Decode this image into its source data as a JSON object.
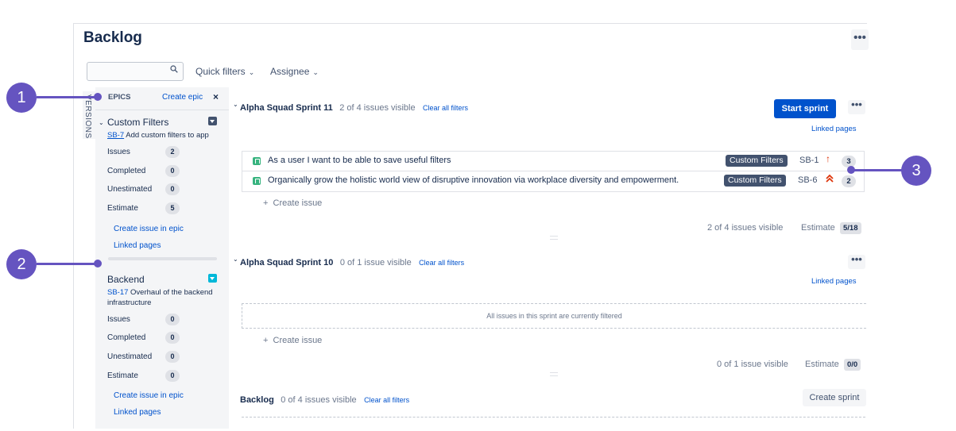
{
  "page": {
    "title": "Backlog",
    "top_more": "•••"
  },
  "toolbar": {
    "search_value": "",
    "quick_filters": "Quick filters",
    "assignee": "Assignee"
  },
  "versions_tab": "VERSIONS",
  "epics_panel": {
    "heading": "EPICS",
    "create_epic": "Create epic",
    "close": "×",
    "epics": [
      {
        "name": "Custom Filters",
        "key": "SB-7",
        "desc": "Add custom filters to app",
        "color": "#42526e",
        "stats": [
          {
            "label": "Issues",
            "value": "2"
          },
          {
            "label": "Completed",
            "value": "0"
          },
          {
            "label": "Unestimated",
            "value": "0"
          },
          {
            "label": "Estimate",
            "value": "5"
          }
        ],
        "create_issue": "Create issue in epic",
        "linked_pages": "Linked pages"
      },
      {
        "name": "Backend",
        "key": "SB-17",
        "desc": "Overhaul of the backend infrastructure",
        "color": "#00b8d9",
        "stats": [
          {
            "label": "Issues",
            "value": "0"
          },
          {
            "label": "Completed",
            "value": "0"
          },
          {
            "label": "Unestimated",
            "value": "0"
          },
          {
            "label": "Estimate",
            "value": "0"
          }
        ],
        "create_issue": "Create issue in epic",
        "linked_pages": "Linked pages"
      }
    ]
  },
  "sprints": [
    {
      "name": "Alpha Squad Sprint 11",
      "visible": "2 of 4 issues visible",
      "clear": "Clear all filters",
      "action": "Start sprint",
      "more": "•••",
      "linked_pages": "Linked pages",
      "issues": [
        {
          "summary": "As a user I want to be able to save useful filters",
          "epic": "Custom Filters",
          "key": "SB-1",
          "priority": "↑",
          "estimate": "3"
        },
        {
          "summary": "Organically grow the holistic world view of disruptive innovation via workplace diversity and empowerment.",
          "epic": "Custom Filters",
          "key": "SB-6",
          "priority": "⌃⌃",
          "estimate": "2"
        }
      ],
      "create_issue": "Create issue",
      "footer_visible": "2 of 4 issues visible",
      "footer_estimate_label": "Estimate",
      "footer_estimate": "5/18"
    },
    {
      "name": "Alpha Squad Sprint 10",
      "visible": "0 of 1 issue visible",
      "clear": "Clear all filters",
      "more": "•••",
      "linked_pages": "Linked pages",
      "filtered_note": "All issues in this sprint are currently filtered",
      "create_issue": "Create issue",
      "footer_visible": "0 of 1 issue visible",
      "footer_estimate_label": "Estimate",
      "footer_estimate": "0/0"
    }
  ],
  "backlog": {
    "name": "Backlog",
    "visible": "0 of 4 issues visible",
    "clear": "Clear all filters",
    "action": "Create sprint"
  },
  "callouts": [
    "1",
    "2",
    "3"
  ],
  "colors": {
    "accent": "#0052cc",
    "callout": "#6554c0",
    "story": "#36b37e",
    "priority": "#de350b"
  },
  "icons": {
    "search": "search-icon",
    "story": "story-icon",
    "priority": "priority-arrow-icon"
  }
}
